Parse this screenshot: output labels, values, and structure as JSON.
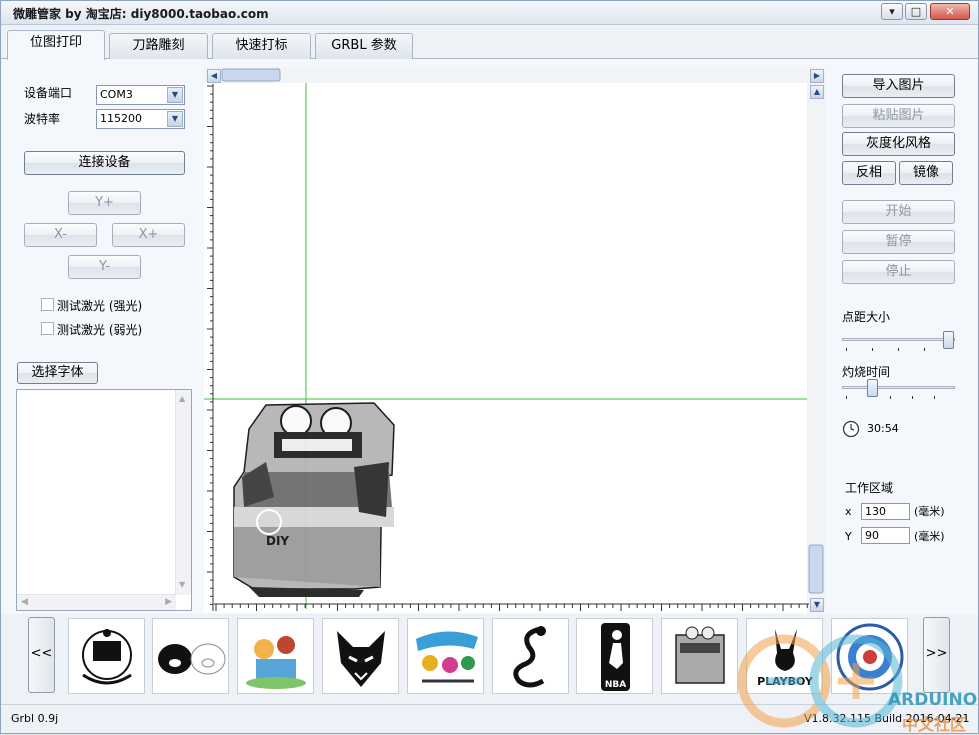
{
  "window": {
    "title": "微雕管家 by 淘宝店:  diy8000.taobao.com",
    "controls": {
      "minimize": "▾",
      "restore": "□",
      "close": "✕"
    }
  },
  "tabs": [
    {
      "label": "位图打印",
      "active": true
    },
    {
      "label": "刀路雕刻",
      "active": false
    },
    {
      "label": "快速打标",
      "active": false
    },
    {
      "label": "GRBL 参数",
      "active": false
    }
  ],
  "left": {
    "port_label": "设备端口",
    "port_value": "COM3",
    "baud_label": "波特率",
    "baud_value": "115200",
    "connect": "连接设备",
    "yplus": "Y+",
    "xminus": "X-",
    "xplus": "X+",
    "yminus": "Y-",
    "laser_strong": "测试激光 (强光)",
    "laser_weak": "测试激光 (弱光)",
    "choose_font": "选择字体"
  },
  "right": {
    "import": "导入图片",
    "paste": "粘贴图片",
    "grayscale": "灰度化风格",
    "invert": "反相",
    "mirror": "镜像",
    "start": "开始",
    "pause": "暂停",
    "stop": "停止",
    "dot_pitch": "点距大小",
    "dot_pitch_level": 1.0,
    "burn_time": "灼烧时间",
    "burn_time_level": 0.25,
    "time": "30:54",
    "work_area": "工作区域",
    "x_label": "x",
    "x_value": "130",
    "y_label": "Y",
    "y_value": "90",
    "unit": "(毫米)"
  },
  "canvas": {
    "print_label": "DIY"
  },
  "thumbnails": {
    "prev": "<<",
    "next": ">>",
    "items": [
      {
        "name": "national-emblem"
      },
      {
        "name": "pigs"
      },
      {
        "name": "cartoon-group"
      },
      {
        "name": "wolf-head"
      },
      {
        "name": "cartoon-party"
      },
      {
        "name": "dragon"
      },
      {
        "name": "nba-logo",
        "text": "NBA"
      },
      {
        "name": "robot-box"
      },
      {
        "name": "playboy-logo",
        "text": "PLAYBOY"
      },
      {
        "name": "round-seal"
      }
    ]
  },
  "status": {
    "left": "Grbl 0.9j",
    "right": "V1.8.32.115 Build 2016-04-21"
  },
  "watermark": {
    "line1": "ARDUINO",
    "line2": "中文社区"
  }
}
